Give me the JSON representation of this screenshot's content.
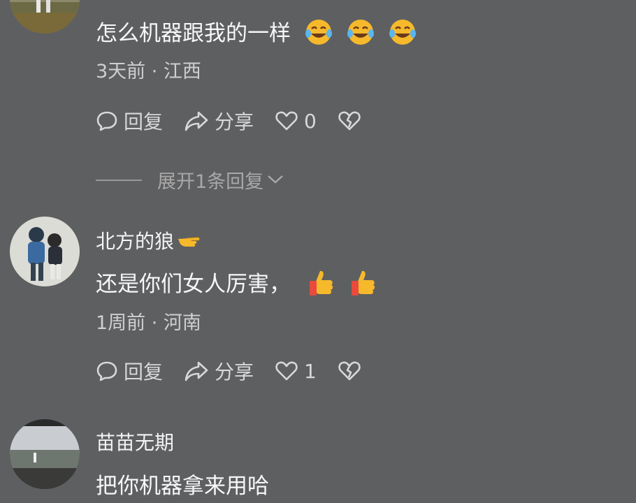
{
  "comments": [
    {
      "username": "",
      "text": "怎么机器跟我的一样",
      "emoji": "laughing-crying-emoji",
      "time": "3天前",
      "location": "江西",
      "meta": "3天前 · 江西",
      "reply_label": "回复",
      "share_label": "分享",
      "like_count": "0",
      "expand_label": "展开1条回复"
    },
    {
      "username": "北方的狼",
      "text": "还是你们女人厉害，",
      "emoji": "thumbs-up-emoji",
      "time": "1周前",
      "location": "河南",
      "meta": "1周前 · 河南",
      "reply_label": "回复",
      "share_label": "分享",
      "like_count": "1"
    },
    {
      "username": "苗苗无期",
      "text": "把你机器拿来用哈"
    }
  ],
  "colors": {
    "background": "#5e5f61",
    "text": "#f7f7f7",
    "meta": "#cfcfcf",
    "emoji_yellow": "#f6b92c",
    "thumb_red": "#e84a3c"
  }
}
